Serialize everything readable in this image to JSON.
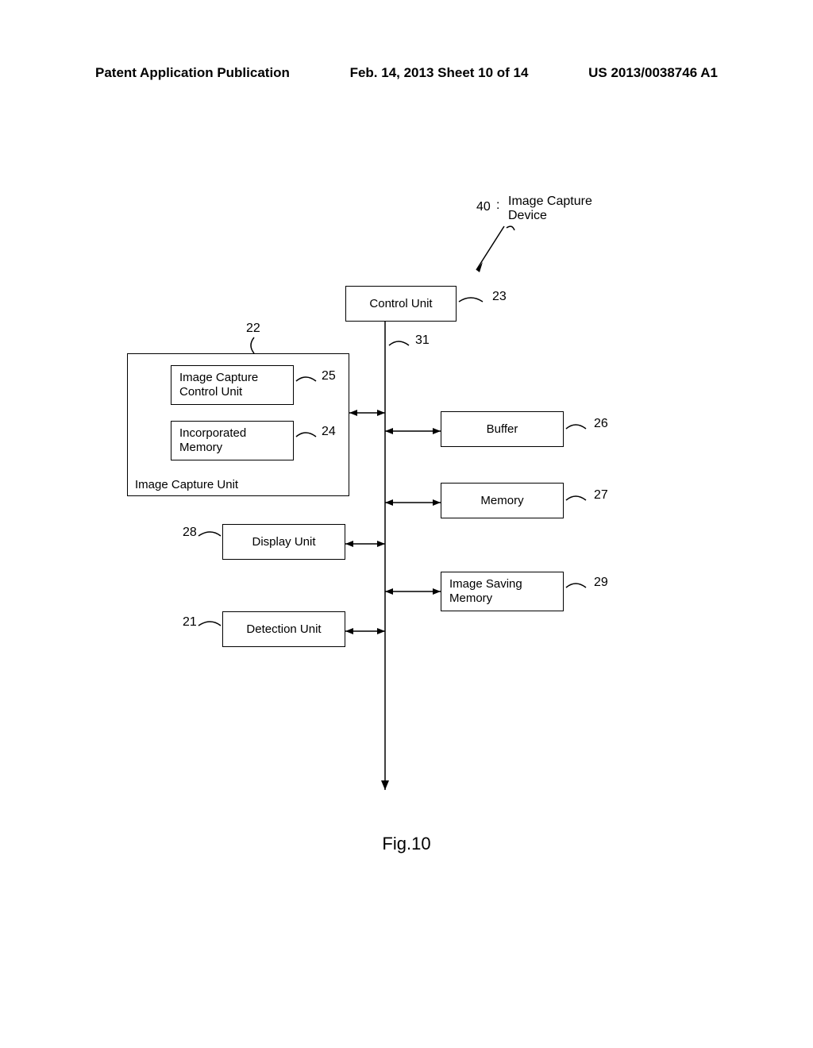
{
  "header": {
    "left": "Patent Application Publication",
    "center": "Feb. 14, 2013  Sheet 10 of 14",
    "right": "US 2013/0038746 A1"
  },
  "diagram": {
    "device_ref": "40",
    "device_label": "Image Capture Device",
    "blocks": {
      "control_unit": {
        "label": "Control Unit",
        "ref": "23"
      },
      "image_capture_unit": {
        "label": "Image Capture Unit",
        "ref": "22"
      },
      "image_capture_control": {
        "label": "Image Capture Control Unit",
        "ref": "25"
      },
      "incorporated_memory": {
        "label": "Incorporated Memory",
        "ref": "24"
      },
      "buffer": {
        "label": "Buffer",
        "ref": "26"
      },
      "memory": {
        "label": "Memory",
        "ref": "27"
      },
      "display_unit": {
        "label": "Display Unit",
        "ref": "28"
      },
      "detection_unit": {
        "label": "Detection Unit",
        "ref": "21"
      },
      "image_saving_memory": {
        "label": "Image Saving Memory",
        "ref": "29"
      },
      "bus_ref": "31"
    }
  },
  "figure_caption": "Fig.10"
}
